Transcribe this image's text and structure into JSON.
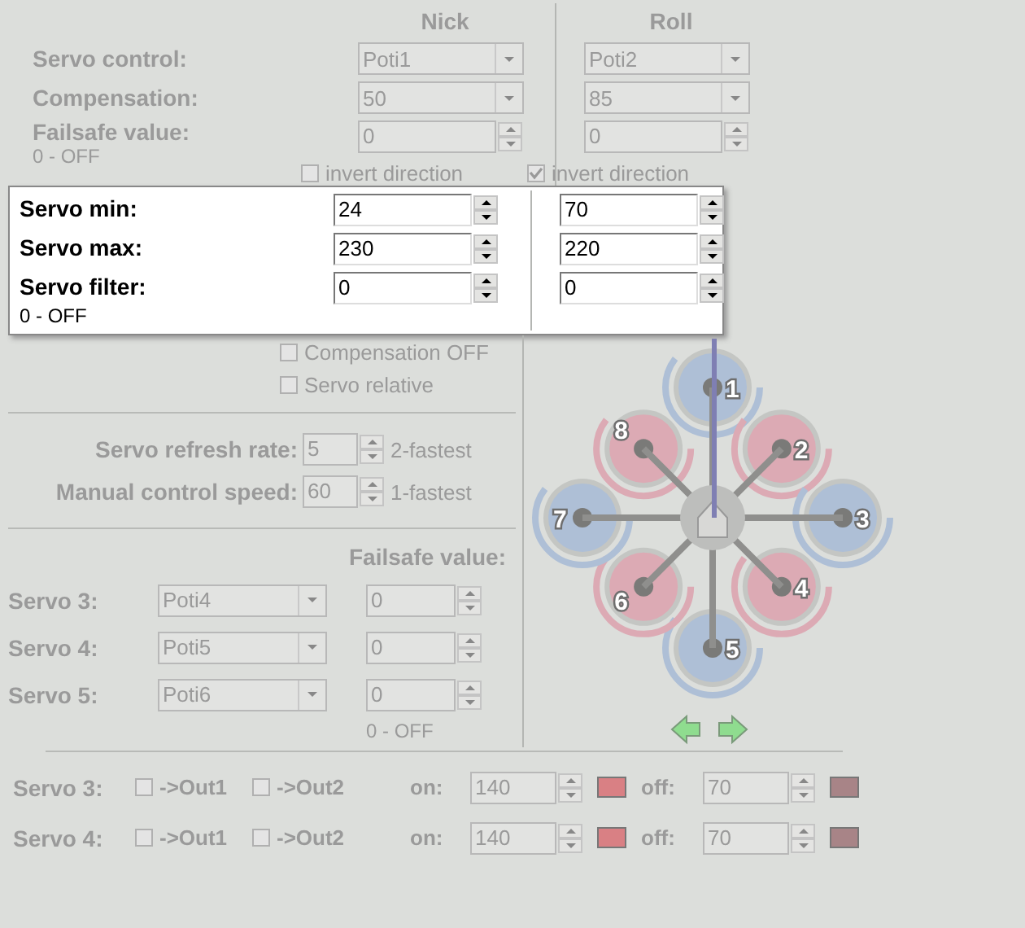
{
  "column_headers": [
    "Nick",
    "Roll"
  ],
  "settings": [
    {
      "kind": "dropdown",
      "label": "Servo control:",
      "disabled": true,
      "values": [
        "Poti1",
        "Poti2"
      ]
    },
    {
      "kind": "dropdown",
      "label": "Compensation:",
      "disabled": true,
      "values": [
        "50",
        "85"
      ]
    },
    {
      "kind": "spinner",
      "label": "Failsafe value:",
      "note": "0 - OFF",
      "disabled": true,
      "values": [
        "0",
        "0"
      ]
    }
  ],
  "invert": [
    {
      "label": "invert direction",
      "checked": false,
      "disabled": true
    },
    {
      "label": "invert direction",
      "checked": true,
      "disabled": true
    }
  ],
  "panel": [
    {
      "label": "Servo min:",
      "values": [
        "24",
        "70"
      ]
    },
    {
      "label": "Servo max:",
      "values": [
        "230",
        "220"
      ]
    },
    {
      "label": "Servo filter:",
      "note": "0 - OFF",
      "values": [
        "0",
        "0"
      ]
    }
  ],
  "options": [
    {
      "label": "Compensation OFF",
      "checked": false,
      "disabled": true
    },
    {
      "label": "Servo relative",
      "checked": false,
      "disabled": true
    }
  ],
  "timing": [
    {
      "label": "Servo refresh rate:",
      "value": "5",
      "hint": "2-fastest",
      "disabled": true
    },
    {
      "label": "Manual control speed:",
      "value": "60",
      "hint": "1-fastest",
      "disabled": true
    }
  ],
  "failsafe_header": "Failsafe value:",
  "extra_servos": [
    {
      "label": "Servo 3:",
      "source": "Poti4",
      "failsafe": "0",
      "disabled": true
    },
    {
      "label": "Servo 4:",
      "source": "Poti5",
      "failsafe": "0",
      "disabled": true
    },
    {
      "label": "Servo 5:",
      "source": "Poti6",
      "failsafe": "0",
      "disabled": true
    }
  ],
  "failsafe_note": "0 - OFF",
  "motors": [
    {
      "number": "1",
      "color": "#aebfd6"
    },
    {
      "number": "2",
      "color": "#dcaab4"
    },
    {
      "number": "3",
      "color": "#aebfd6"
    },
    {
      "number": "4",
      "color": "#dcaab4"
    },
    {
      "number": "5",
      "color": "#aebfd6"
    },
    {
      "number": "6",
      "color": "#dcaab4"
    },
    {
      "number": "7",
      "color": "#aebfd6"
    },
    {
      "number": "8",
      "color": "#dcaab4"
    }
  ],
  "outputs": [
    {
      "label": "Servo 3:",
      "disabled": true,
      "out1": {
        "label": "->Out1",
        "checked": false
      },
      "out2": {
        "label": "->Out2",
        "checked": false
      },
      "on_label": "on:",
      "on": {
        "value": "140",
        "color": "#d98084"
      },
      "off_label": "off:",
      "off": {
        "value": "70",
        "color": "#a88487"
      }
    },
    {
      "label": "Servo 4:",
      "disabled": true,
      "out1": {
        "label": "->Out1",
        "checked": false
      },
      "out2": {
        "label": "->Out2",
        "checked": false
      },
      "on_label": "on:",
      "on": {
        "value": "140",
        "color": "#d98084"
      },
      "off_label": "off:",
      "off": {
        "value": "70",
        "color": "#a88487"
      }
    }
  ]
}
